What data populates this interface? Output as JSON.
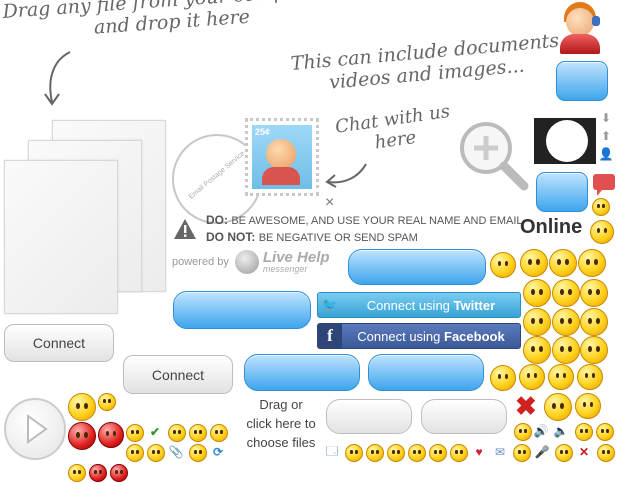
{
  "drag_hint": {
    "line1": "Drag any file from your computer",
    "line2": "and drop it here"
  },
  "include_hint": {
    "line1": "This can include documents",
    "line2": "videos and images..."
  },
  "chat_hint": {
    "line1": "Chat with us",
    "line2": "here"
  },
  "stamp": {
    "price": "25¢",
    "ring_text": "Email Postage Service"
  },
  "do_rule": {
    "label": "DO:",
    "text": "BE AWESOME, AND USE YOUR REAL NAME AND EMAIL"
  },
  "dont_rule": {
    "label": "DO NOT:",
    "text": "BE NEGATIVE OR SEND SPAM"
  },
  "powered": {
    "prefix": "powered by",
    "brand": "Live Help",
    "brand_sub": "messenger"
  },
  "close_glyph": "×",
  "connect_label": "Connect",
  "twitter": {
    "prefix": "Connect using ",
    "name": "Twitter"
  },
  "facebook": {
    "prefix": "Connect using ",
    "name": "Facebook"
  },
  "online_label": "Online",
  "drag_click": {
    "line1": "Drag or",
    "line2": "click here to",
    "line3": "choose files"
  },
  "colors": {
    "blue": "#3ea5ec",
    "twitter": "#4fb3e0",
    "facebook": "#3b5998",
    "alert_red": "#e05050"
  },
  "icons": [
    "support-agent-icon",
    "magnifier-plus-icon",
    "warning-icon",
    "play-icon",
    "close-x-icon",
    "check-icon",
    "chat-bubble-icon",
    "arrow-down-icon",
    "arrow-up-icon",
    "user-icon",
    "heart-icon",
    "mail-icon",
    "sound-icon",
    "refresh-icon",
    "window-icon"
  ]
}
